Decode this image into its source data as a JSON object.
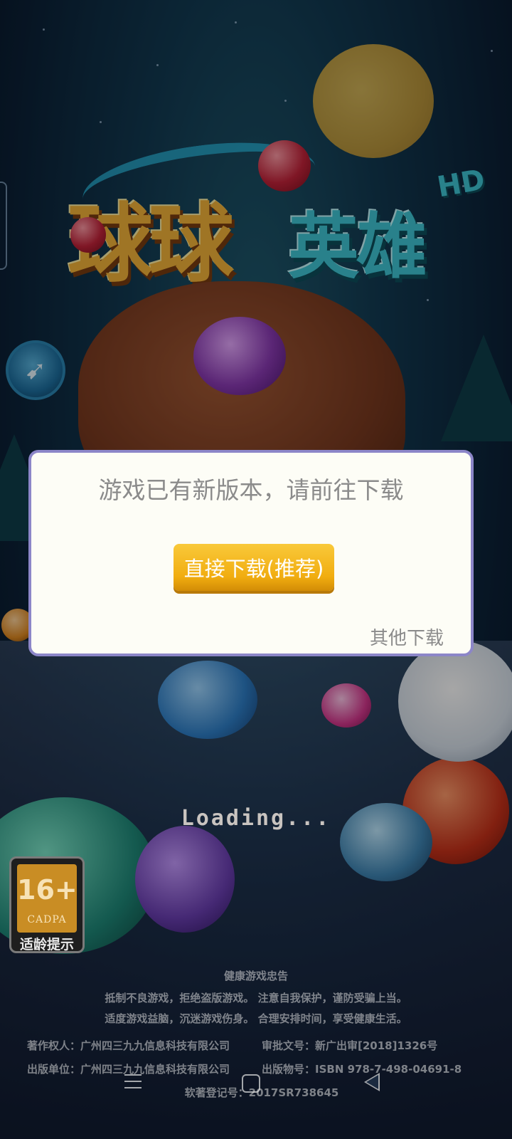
{
  "game": {
    "logo_title_part1": "球球",
    "logo_title_part2": "英雄",
    "logo_badge": "HD"
  },
  "dialog": {
    "message": "游戏已有新版本，请前往下载",
    "primary_button": "直接下载(推荐)",
    "secondary_link": "其他下载"
  },
  "loading_text": "Loading...",
  "age_rating": {
    "age": "16+",
    "org": "CADPA",
    "tip": "适龄提示"
  },
  "advisory": {
    "title": "健康游戏忠告",
    "line1": "抵制不良游戏，拒绝盗版游戏。 注意自我保护，谨防受骗上当。",
    "line2": "适度游戏益脑，沉迷游戏伤身。 合理安排时间，享受健康生活。"
  },
  "copyright": {
    "owner": "著作权人：广州四三九九信息科技有限公司",
    "approval": "审批文号：新广出审[2018]1326号",
    "publisher": "出版单位：广州四三九九信息科技有限公司",
    "isbn": "出版物号：ISBN 978-7-498-04691-8",
    "software_reg": "软著登记号：2017SR738645"
  },
  "colors": {
    "button_gold": "#f1ad10",
    "dialog_border": "#8c86c8",
    "dialog_bg": "#fdfdf6",
    "dialog_text": "#8b8b8b"
  }
}
